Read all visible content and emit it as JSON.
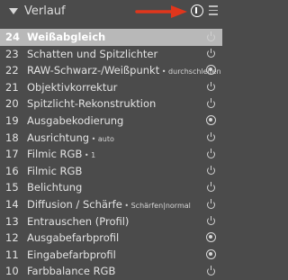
{
  "header": {
    "title": "Verlauf"
  },
  "items": [
    {
      "num": "24",
      "label": "Weißabgleich",
      "suffix": "",
      "state": "power",
      "selected": true
    },
    {
      "num": "23",
      "label": "Schatten und Spitzlichter",
      "suffix": "",
      "state": "power"
    },
    {
      "num": "22",
      "label": "RAW-Schwarz-/Weißpunkt",
      "suffix": " • durchschleifen",
      "state": "dot"
    },
    {
      "num": "21",
      "label": "Objektivkorrektur",
      "suffix": "",
      "state": "power"
    },
    {
      "num": "20",
      "label": "Spitzlicht-Rekonstruktion",
      "suffix": "",
      "state": "power"
    },
    {
      "num": "19",
      "label": "Ausgabekodierung",
      "suffix": "",
      "state": "dot"
    },
    {
      "num": "18",
      "label": "Ausrichtung",
      "suffix": " • auto",
      "state": "power"
    },
    {
      "num": "17",
      "label": "Filmic RGB",
      "suffix": " • 1",
      "state": "power"
    },
    {
      "num": "16",
      "label": "Filmic RGB",
      "suffix": "",
      "state": "power"
    },
    {
      "num": "15",
      "label": "Belichtung",
      "suffix": "",
      "state": "power"
    },
    {
      "num": "14",
      "label": "Diffusion / Schärfe",
      "suffix": " • Schärfen|normal",
      "state": "power"
    },
    {
      "num": "13",
      "label": "Entrauschen (Profil)",
      "suffix": "",
      "state": "power"
    },
    {
      "num": "12",
      "label": "Ausgabefarbprofil",
      "suffix": "",
      "state": "dot"
    },
    {
      "num": "11",
      "label": "Eingabefarbprofil",
      "suffix": "",
      "state": "dot"
    },
    {
      "num": "10",
      "label": "Farbbalance RGB",
      "suffix": "",
      "state": "power"
    }
  ]
}
